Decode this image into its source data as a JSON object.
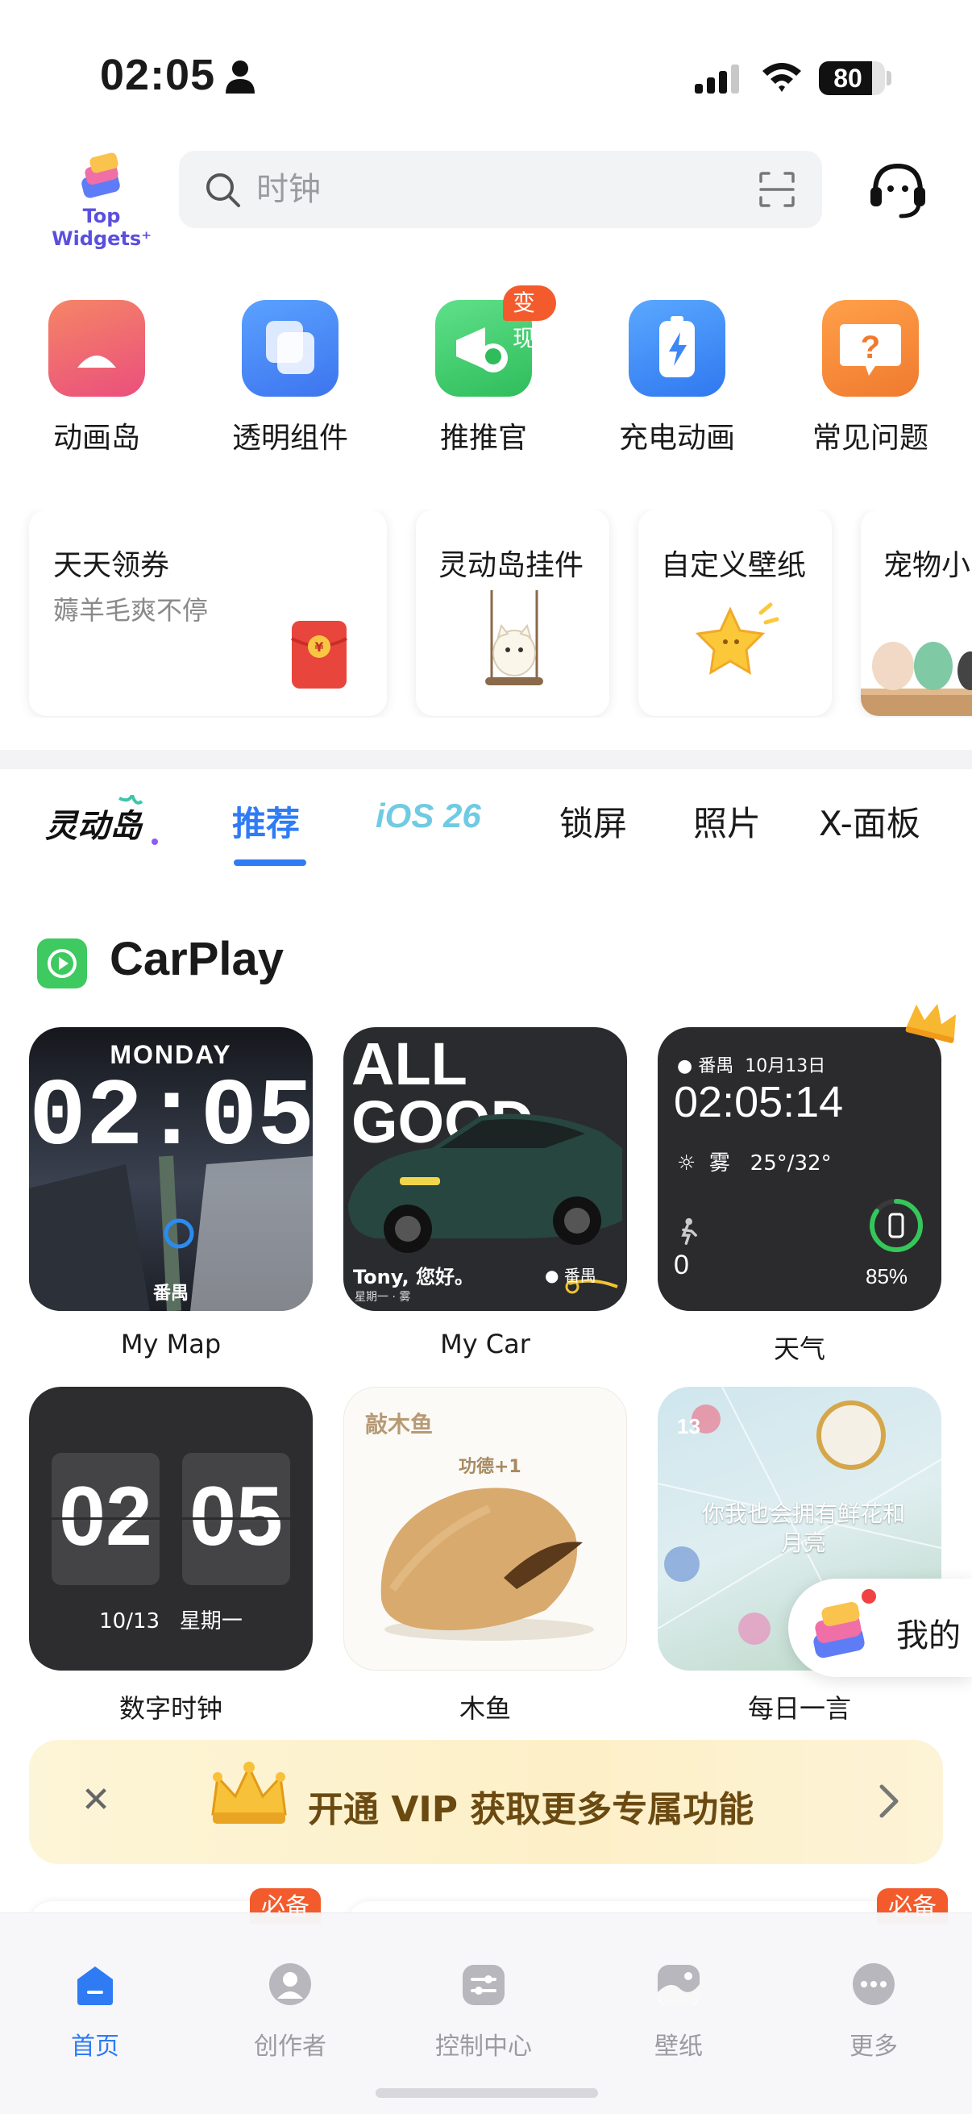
{
  "status_bar": {
    "time": "02:05",
    "battery": "80",
    "battery_level": 0.8
  },
  "header": {
    "logo_text": "Top Widgets⁺",
    "search_placeholder": "时钟"
  },
  "quick_actions": [
    {
      "label": "动画岛",
      "color": "#f1636b"
    },
    {
      "label": "透明组件",
      "color": "#4b8ff5"
    },
    {
      "label": "推推官",
      "color": "#4cd572",
      "badge": "变现"
    },
    {
      "label": "充电动画",
      "color": "#3c8ef6"
    },
    {
      "label": "常见问题",
      "color": "#f5893a"
    }
  ],
  "feature_cards": [
    {
      "title": "天天领券",
      "subtitle": "薅羊毛爽不停"
    },
    {
      "title": "灵动岛挂件"
    },
    {
      "title": "自定义壁纸"
    },
    {
      "title": "宠物小"
    }
  ],
  "tabs": [
    {
      "label": "推荐",
      "active": true
    },
    {
      "label": "iOS 26"
    },
    {
      "label": "锁屏"
    },
    {
      "label": "照片"
    },
    {
      "label": "X-面板"
    }
  ],
  "section": {
    "title": "CarPlay"
  },
  "widgets": {
    "my_map": {
      "label": "My Map",
      "day": "MONDAY",
      "hour": "02",
      "minute": "05",
      "place": "番禺"
    },
    "my_car": {
      "label": "My Car",
      "headline_1": "ALL",
      "headline_2": "GOOD",
      "greeting": "Tony, 您好。",
      "place": "番禺",
      "sub": "星期一 · 雾"
    },
    "weather": {
      "label": "天气",
      "place": "番禺",
      "date": "10月13日",
      "time": "02:05:14",
      "condition": "雾",
      "temp": "25°/32°",
      "steps": "0",
      "battery_pct": "85%",
      "battery_level": 0.85
    },
    "digital_clock": {
      "label": "数字时钟",
      "hour": "02",
      "minute": "05",
      "date": "10/13",
      "weekday": "星期一"
    },
    "muyu": {
      "label": "木鱼",
      "title": "敲木鱼",
      "merit": "功德+1"
    },
    "daily_quote": {
      "label": "每日一言",
      "date": "13",
      "quote": "你我也会拥有鲜花和月亮"
    }
  },
  "vip_banner": {
    "text": "开通 VIP 获取更多专属功能"
  },
  "floating_button": {
    "label": "我的"
  },
  "peek_badges": [
    "必备",
    "必备"
  ],
  "tab_bar": [
    {
      "label": "首页",
      "active": true
    },
    {
      "label": "创作者"
    },
    {
      "label": "控制中心"
    },
    {
      "label": "壁纸"
    },
    {
      "label": "更多"
    }
  ]
}
